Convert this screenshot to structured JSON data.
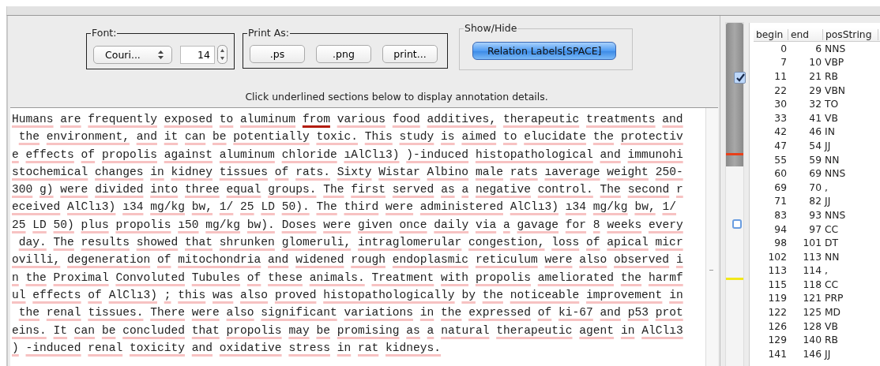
{
  "font_group": {
    "title": "Font:",
    "font_select": "Couri...",
    "size_field": "14"
  },
  "print_group": {
    "title": "Print As:",
    "buttons": [
      ".ps",
      ".png",
      "print..."
    ]
  },
  "show_hide_group": {
    "title": "Show/Hide",
    "toggle": {
      "label": "Relation Labels[SPACE]",
      "selected": true
    }
  },
  "instruction": "Click underlined sections below to display annotation details.",
  "text_lines": [
    {
      "segments": [
        {
          "text": "Humans are frequently exposed to aluminum ",
          "selected": false
        },
        {
          "text": "from",
          "selected": true
        },
        {
          "text": " various food additives, therapeutic treatments and",
          "selected": false
        }
      ]
    },
    {
      "segments": [
        {
          "text": " the environment, and it can be potentially toxic. This study is aimed to elucidate the protectiv",
          "selected": false
        }
      ]
    },
    {
      "segments": [
        {
          "text": "e effects of propolis against aluminum chloride ıAlClı3) )-induced histopathological and immunohi",
          "selected": false
        }
      ]
    },
    {
      "segments": [
        {
          "text": "stochemical changes in kidney tissues of rats. Sixty Wistar Albino male rats ıaverage weight 250-",
          "selected": false
        }
      ]
    },
    {
      "segments": [
        {
          "text": "300 g) were divided into three equal groups. The first served as a negative control. The second r",
          "selected": false
        }
      ]
    },
    {
      "segments": [
        {
          "text": "eceived AlClı3) ı34 mg/kg bw, 1/ 25 LD 50). The third were administered AlClı3) ı34 mg/kg bw, 1/",
          "selected": false
        }
      ]
    },
    {
      "segments": [
        {
          "text": "25 LD 50) plus propolis ı50 mg/kg bw). Doses were given once daily via a gavage for 8 weeks every",
          "selected": false
        }
      ]
    },
    {
      "segments": [
        {
          "text": " day. The results showed that shrunken glomeruli, intraglomerular congestion, loss of apical micr",
          "selected": false
        }
      ]
    },
    {
      "segments": [
        {
          "text": "ovilli, degeneration of mitochondria and widened rough endoplasmic reticulum were also observed i",
          "selected": false
        }
      ]
    },
    {
      "segments": [
        {
          "text": "n the Proximal Convoluted Tubules of these animals. Treatment with propolis ameliorated the harmf",
          "selected": false
        }
      ]
    },
    {
      "segments": [
        {
          "text": "ul effects of AlClı3) ; this was also proved histopathologically by the noticeable improvement in",
          "selected": false
        }
      ]
    },
    {
      "segments": [
        {
          "text": " the renal tissues. There were also significant variations in the expressed of ki-67 and p53 prot",
          "selected": false
        }
      ]
    },
    {
      "segments": [
        {
          "text": "eins. It can be concluded that propolis may be promising as a natural therapeutic agent in AlClı3",
          "selected": false
        }
      ]
    },
    {
      "segments": [
        {
          "text": ") -induced renal toxicity and oxidative stress in rat kidneys.",
          "selected": false
        }
      ]
    }
  ],
  "overview_checkbox": {
    "checked": true
  },
  "table": {
    "columns": [
      "begin",
      "end",
      "posString"
    ],
    "rows": [
      [
        "0",
        "6",
        "NNS"
      ],
      [
        "7",
        "10",
        "VBP"
      ],
      [
        "11",
        "21",
        "RB"
      ],
      [
        "22",
        "29",
        "VBN"
      ],
      [
        "30",
        "32",
        "TO"
      ],
      [
        "33",
        "41",
        "VB"
      ],
      [
        "42",
        "46",
        "IN"
      ],
      [
        "47",
        "54",
        "JJ"
      ],
      [
        "55",
        "59",
        "NN"
      ],
      [
        "60",
        "69",
        "NNS"
      ],
      [
        "69",
        "70",
        ","
      ],
      [
        "71",
        "82",
        "JJ"
      ],
      [
        "83",
        "93",
        "NNS"
      ],
      [
        "94",
        "97",
        "CC"
      ],
      [
        "98",
        "101",
        "DT"
      ],
      [
        "102",
        "113",
        "NN"
      ],
      [
        "113",
        "114",
        ","
      ],
      [
        "115",
        "118",
        "CC"
      ],
      [
        "119",
        "121",
        "PRP"
      ],
      [
        "122",
        "125",
        "MD"
      ],
      [
        "126",
        "128",
        "VB"
      ],
      [
        "129",
        "140",
        "RB"
      ],
      [
        "141",
        "146",
        "JJ"
      ]
    ]
  }
}
